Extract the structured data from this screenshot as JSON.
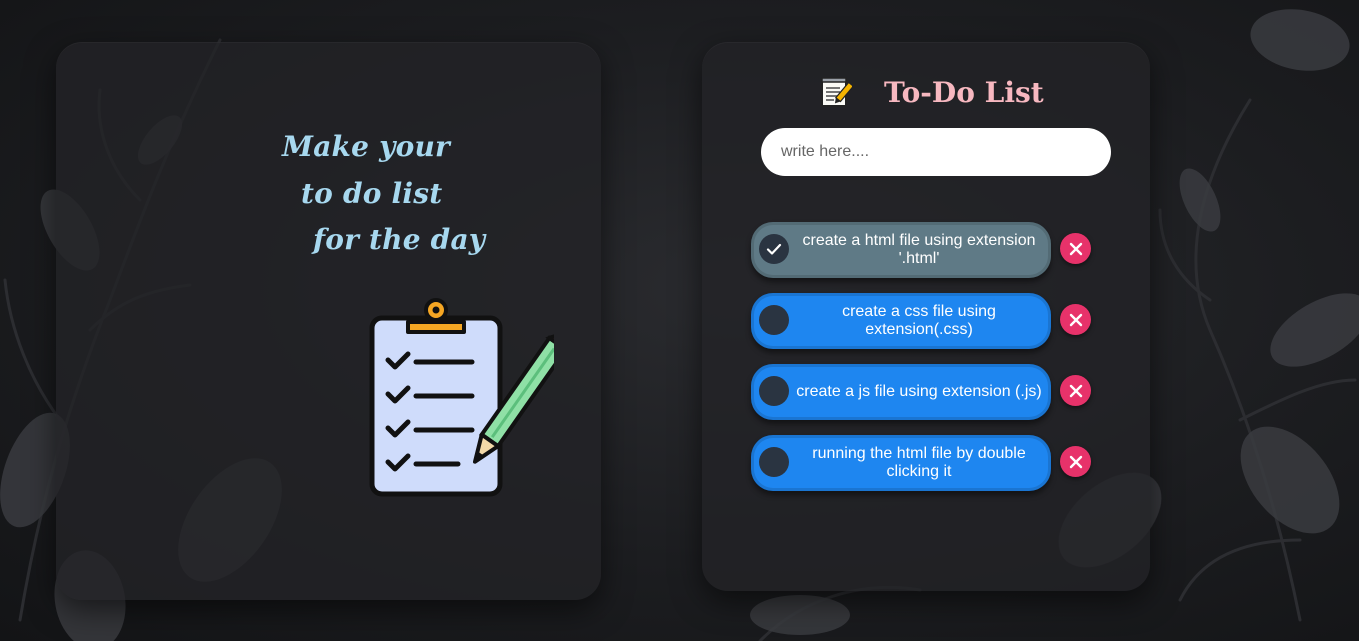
{
  "left_panel": {
    "tagline": [
      "Make your",
      "to do list",
      "for the day"
    ]
  },
  "header": {
    "title": "To-Do List",
    "icon": "memo-icon"
  },
  "input": {
    "value": "",
    "placeholder": "write here...."
  },
  "tasks": [
    {
      "text": "create a html file using extension '.html'",
      "completed": true
    },
    {
      "text": "create a css file using extension(.css)",
      "completed": false
    },
    {
      "text": "create a js file using extension (.js)",
      "completed": false
    },
    {
      "text": "running the html file by double clicking it",
      "completed": false
    }
  ],
  "colors": {
    "tagline": "#a7d8ef",
    "title": "#f7b8c0",
    "task_pending": "#1e86f0",
    "task_completed": "#5f7a86",
    "delete": "#e7326a"
  },
  "icons": {
    "delete": "close-icon",
    "checked": "checkmark-icon",
    "illustration": "clipboard-checklist-icon"
  }
}
